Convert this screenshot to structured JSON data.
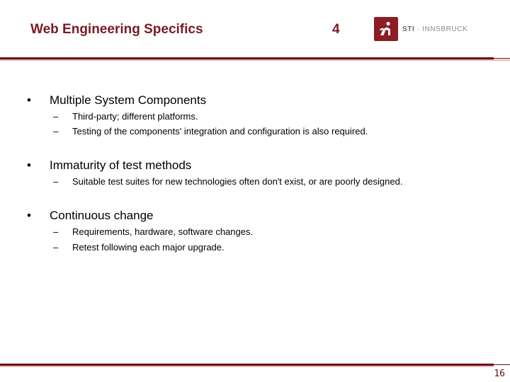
{
  "header": {
    "title": "Web Engineering Specifics",
    "lecture_number": "4",
    "logo": {
      "icon": "sti-runner-icon",
      "brand_bold": "STI",
      "separator": "·",
      "brand_rest": "INNSBRUCK"
    }
  },
  "colors": {
    "accent": "#7a1b24",
    "rule_dark": "#6b0f14",
    "rule_light": "#e8b9bd",
    "logo_bg": "#8b1d24"
  },
  "content": {
    "bullets": [
      {
        "marker": "•",
        "text": "Multiple System Components",
        "subitems": [
          {
            "marker": "–",
            "text": "Third-party; different platforms."
          },
          {
            "marker": "–",
            "text": "Testing of the components' integration and configuration is also required."
          }
        ]
      },
      {
        "marker": "•",
        "text": "Immaturity of test methods",
        "subitems": [
          {
            "marker": "–",
            "text": "Suitable test suites for new technologies often don't exist, or are poorly designed."
          }
        ]
      },
      {
        "marker": "•",
        "text": "Continuous change",
        "subitems": [
          {
            "marker": "–",
            "text": "Requirements, hardware, software changes."
          },
          {
            "marker": "–",
            "text": "Retest following each major upgrade."
          }
        ]
      }
    ]
  },
  "footer": {
    "page_number": "16"
  }
}
